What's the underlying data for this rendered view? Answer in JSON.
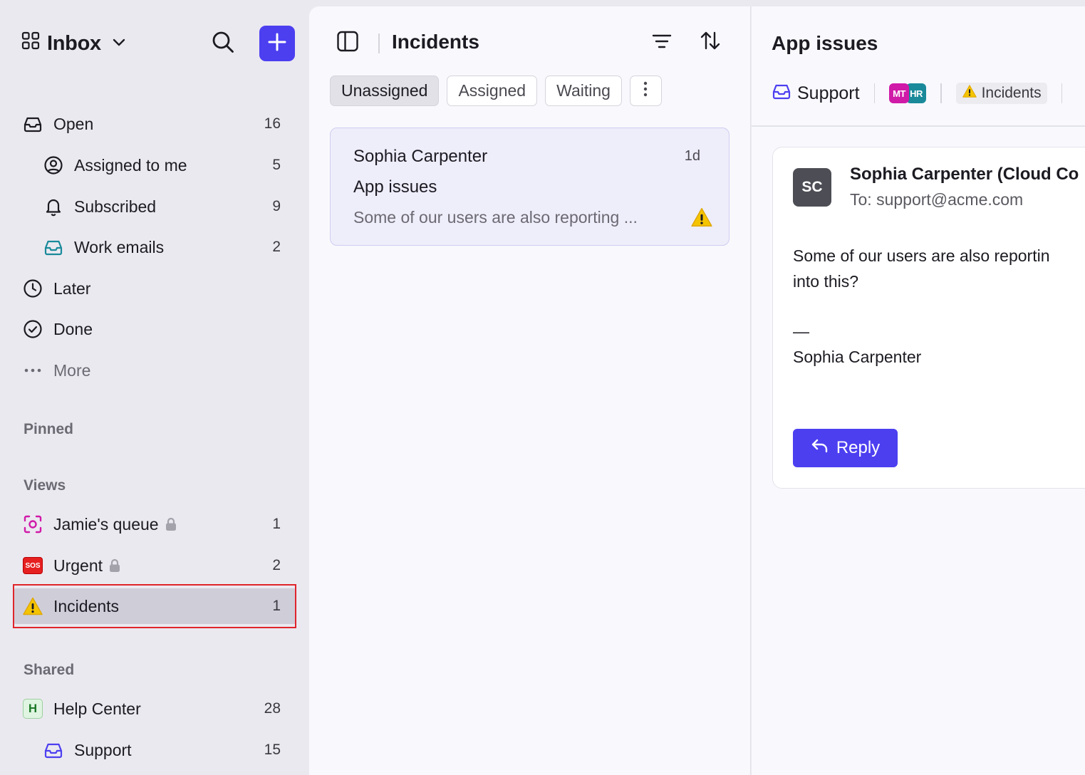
{
  "sidebar": {
    "title": "Inbox",
    "items": [
      {
        "label": "Open",
        "count": "16"
      },
      {
        "label": "Assigned to me",
        "count": "5"
      },
      {
        "label": "Subscribed",
        "count": "9"
      },
      {
        "label": "Work emails",
        "count": "2"
      },
      {
        "label": "Later"
      },
      {
        "label": "Done"
      },
      {
        "label": "More"
      }
    ],
    "pinned_title": "Pinned",
    "views_title": "Views",
    "views": [
      {
        "label": "Jamie's queue",
        "count": "1"
      },
      {
        "label": "Urgent",
        "count": "2",
        "badge": "SOS"
      },
      {
        "label": "Incidents",
        "count": "1"
      }
    ],
    "shared_title": "Shared",
    "shared": [
      {
        "label": "Help Center",
        "count": "28",
        "badge": "H"
      },
      {
        "label": "Support",
        "count": "15"
      }
    ]
  },
  "list": {
    "title": "Incidents",
    "tabs": [
      "Unassigned",
      "Assigned",
      "Waiting"
    ],
    "conversation": {
      "from": "Sophia Carpenter",
      "age": "1d",
      "subject": "App issues",
      "snippet": "Some of our users are also reporting ..."
    }
  },
  "detail": {
    "title": "App issues",
    "inbox": "Support",
    "assignees": [
      "MT",
      "HR"
    ],
    "tag": "Incidents",
    "message": {
      "avatar": "SC",
      "from": "Sophia Carpenter (Cloud Co",
      "to": "To: support@acme.com",
      "body_line1": "Some of our users are also reportin",
      "body_line2": "into this?",
      "signature_dash": "—",
      "signature_name": "Sophia Carpenter",
      "reply_label": "Reply"
    }
  },
  "colors": {
    "accent": "#4c3ff0",
    "selection_outline": "#e0242b",
    "warning": "#f5c400"
  }
}
